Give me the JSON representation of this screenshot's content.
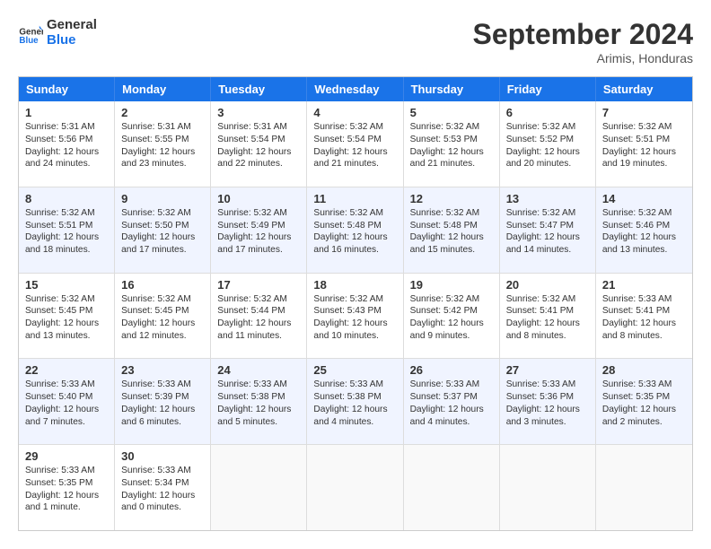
{
  "logo": {
    "text_general": "General",
    "text_blue": "Blue"
  },
  "header": {
    "month": "September 2024",
    "location": "Arimis, Honduras"
  },
  "weekdays": [
    "Sunday",
    "Monday",
    "Tuesday",
    "Wednesday",
    "Thursday",
    "Friday",
    "Saturday"
  ],
  "rows": [
    {
      "alt": false,
      "cells": [
        {
          "day": "1",
          "lines": [
            "Sunrise: 5:31 AM",
            "Sunset: 5:56 PM",
            "Daylight: 12 hours",
            "and 24 minutes."
          ]
        },
        {
          "day": "2",
          "lines": [
            "Sunrise: 5:31 AM",
            "Sunset: 5:55 PM",
            "Daylight: 12 hours",
            "and 23 minutes."
          ]
        },
        {
          "day": "3",
          "lines": [
            "Sunrise: 5:31 AM",
            "Sunset: 5:54 PM",
            "Daylight: 12 hours",
            "and 22 minutes."
          ]
        },
        {
          "day": "4",
          "lines": [
            "Sunrise: 5:32 AM",
            "Sunset: 5:54 PM",
            "Daylight: 12 hours",
            "and 21 minutes."
          ]
        },
        {
          "day": "5",
          "lines": [
            "Sunrise: 5:32 AM",
            "Sunset: 5:53 PM",
            "Daylight: 12 hours",
            "and 21 minutes."
          ]
        },
        {
          "day": "6",
          "lines": [
            "Sunrise: 5:32 AM",
            "Sunset: 5:52 PM",
            "Daylight: 12 hours",
            "and 20 minutes."
          ]
        },
        {
          "day": "7",
          "lines": [
            "Sunrise: 5:32 AM",
            "Sunset: 5:51 PM",
            "Daylight: 12 hours",
            "and 19 minutes."
          ]
        }
      ]
    },
    {
      "alt": true,
      "cells": [
        {
          "day": "8",
          "lines": [
            "Sunrise: 5:32 AM",
            "Sunset: 5:51 PM",
            "Daylight: 12 hours",
            "and 18 minutes."
          ]
        },
        {
          "day": "9",
          "lines": [
            "Sunrise: 5:32 AM",
            "Sunset: 5:50 PM",
            "Daylight: 12 hours",
            "and 17 minutes."
          ]
        },
        {
          "day": "10",
          "lines": [
            "Sunrise: 5:32 AM",
            "Sunset: 5:49 PM",
            "Daylight: 12 hours",
            "and 17 minutes."
          ]
        },
        {
          "day": "11",
          "lines": [
            "Sunrise: 5:32 AM",
            "Sunset: 5:48 PM",
            "Daylight: 12 hours",
            "and 16 minutes."
          ]
        },
        {
          "day": "12",
          "lines": [
            "Sunrise: 5:32 AM",
            "Sunset: 5:48 PM",
            "Daylight: 12 hours",
            "and 15 minutes."
          ]
        },
        {
          "day": "13",
          "lines": [
            "Sunrise: 5:32 AM",
            "Sunset: 5:47 PM",
            "Daylight: 12 hours",
            "and 14 minutes."
          ]
        },
        {
          "day": "14",
          "lines": [
            "Sunrise: 5:32 AM",
            "Sunset: 5:46 PM",
            "Daylight: 12 hours",
            "and 13 minutes."
          ]
        }
      ]
    },
    {
      "alt": false,
      "cells": [
        {
          "day": "15",
          "lines": [
            "Sunrise: 5:32 AM",
            "Sunset: 5:45 PM",
            "Daylight: 12 hours",
            "and 13 minutes."
          ]
        },
        {
          "day": "16",
          "lines": [
            "Sunrise: 5:32 AM",
            "Sunset: 5:45 PM",
            "Daylight: 12 hours",
            "and 12 minutes."
          ]
        },
        {
          "day": "17",
          "lines": [
            "Sunrise: 5:32 AM",
            "Sunset: 5:44 PM",
            "Daylight: 12 hours",
            "and 11 minutes."
          ]
        },
        {
          "day": "18",
          "lines": [
            "Sunrise: 5:32 AM",
            "Sunset: 5:43 PM",
            "Daylight: 12 hours",
            "and 10 minutes."
          ]
        },
        {
          "day": "19",
          "lines": [
            "Sunrise: 5:32 AM",
            "Sunset: 5:42 PM",
            "Daylight: 12 hours",
            "and 9 minutes."
          ]
        },
        {
          "day": "20",
          "lines": [
            "Sunrise: 5:32 AM",
            "Sunset: 5:41 PM",
            "Daylight: 12 hours",
            "and 8 minutes."
          ]
        },
        {
          "day": "21",
          "lines": [
            "Sunrise: 5:33 AM",
            "Sunset: 5:41 PM",
            "Daylight: 12 hours",
            "and 8 minutes."
          ]
        }
      ]
    },
    {
      "alt": true,
      "cells": [
        {
          "day": "22",
          "lines": [
            "Sunrise: 5:33 AM",
            "Sunset: 5:40 PM",
            "Daylight: 12 hours",
            "and 7 minutes."
          ]
        },
        {
          "day": "23",
          "lines": [
            "Sunrise: 5:33 AM",
            "Sunset: 5:39 PM",
            "Daylight: 12 hours",
            "and 6 minutes."
          ]
        },
        {
          "day": "24",
          "lines": [
            "Sunrise: 5:33 AM",
            "Sunset: 5:38 PM",
            "Daylight: 12 hours",
            "and 5 minutes."
          ]
        },
        {
          "day": "25",
          "lines": [
            "Sunrise: 5:33 AM",
            "Sunset: 5:38 PM",
            "Daylight: 12 hours",
            "and 4 minutes."
          ]
        },
        {
          "day": "26",
          "lines": [
            "Sunrise: 5:33 AM",
            "Sunset: 5:37 PM",
            "Daylight: 12 hours",
            "and 4 minutes."
          ]
        },
        {
          "day": "27",
          "lines": [
            "Sunrise: 5:33 AM",
            "Sunset: 5:36 PM",
            "Daylight: 12 hours",
            "and 3 minutes."
          ]
        },
        {
          "day": "28",
          "lines": [
            "Sunrise: 5:33 AM",
            "Sunset: 5:35 PM",
            "Daylight: 12 hours",
            "and 2 minutes."
          ]
        }
      ]
    },
    {
      "alt": false,
      "cells": [
        {
          "day": "29",
          "lines": [
            "Sunrise: 5:33 AM",
            "Sunset: 5:35 PM",
            "Daylight: 12 hours",
            "and 1 minute."
          ]
        },
        {
          "day": "30",
          "lines": [
            "Sunrise: 5:33 AM",
            "Sunset: 5:34 PM",
            "Daylight: 12 hours",
            "and 0 minutes."
          ]
        },
        {
          "day": "",
          "lines": []
        },
        {
          "day": "",
          "lines": []
        },
        {
          "day": "",
          "lines": []
        },
        {
          "day": "",
          "lines": []
        },
        {
          "day": "",
          "lines": []
        }
      ]
    }
  ]
}
